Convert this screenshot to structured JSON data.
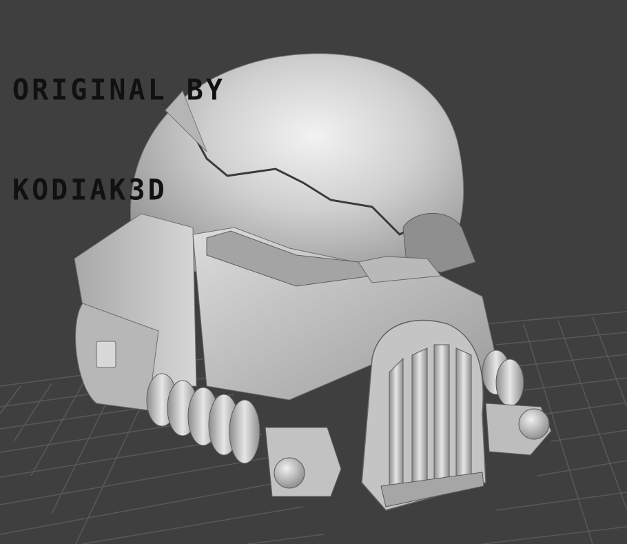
{
  "viewport": {
    "background_color": "#3f3f3f",
    "grid_color": "#5a5a5a",
    "model_color": "#c8c8c8"
  },
  "overlay": {
    "line1": "ORIGINAL BY",
    "line2": "KODIAK3D"
  },
  "model": {
    "name": "helmet-model"
  }
}
